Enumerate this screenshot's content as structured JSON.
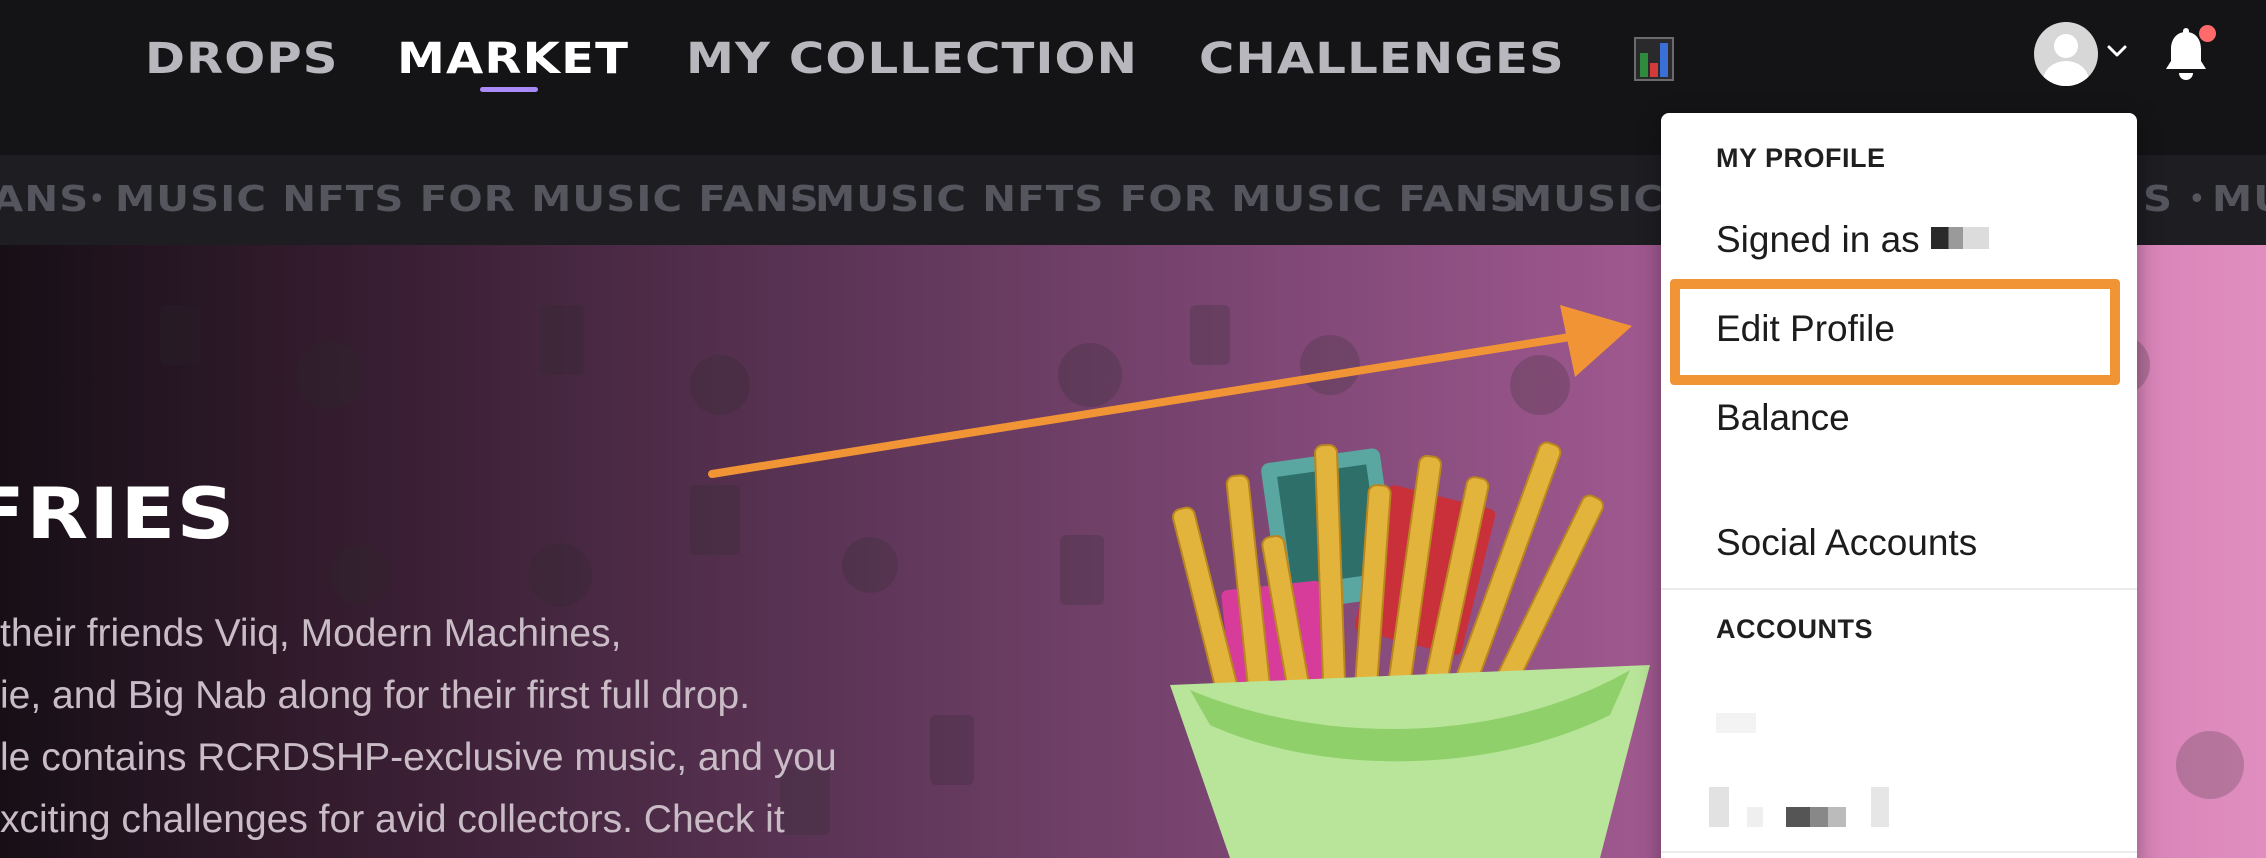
{
  "nav": {
    "items": [
      "DROPS",
      "MARKET",
      "MY COLLECTION",
      "CHALLENGES"
    ],
    "active": "MARKET"
  },
  "ticker": {
    "text": "MUSIC NFTS FOR MUSIC FANS",
    "head_fragment": "ANS",
    "tail_fragment": "MUSIC",
    "right_fragment_1": "S",
    "right_fragment_2": "MU",
    "separator": "•"
  },
  "hero": {
    "title": "FRIES",
    "lines": [
      "their friends Viiq, Modern Machines,",
      "ie, and Big Nab along for their first full drop.",
      "le contains RCRDSHP-exclusive music, and you",
      "xciting challenges for avid collectors. Check it"
    ]
  },
  "dropdown": {
    "profile_section": "MY PROFILE",
    "signed_in_label": "Signed in as",
    "edit_profile": "Edit Profile",
    "balance": "Balance",
    "social_accounts": "Social Accounts",
    "accounts_section": "ACCOUNTS"
  },
  "colors": {
    "nav_bg": "#141416",
    "ticker_bg": "#1d1d22",
    "accent_underline": "#a98af7",
    "annotation_orange": "#f19436",
    "notification_dot": "#ff6b6b"
  },
  "icons": [
    "leaderboard-icon",
    "user-avatar-icon",
    "chevron-down-icon",
    "bell-icon"
  ]
}
